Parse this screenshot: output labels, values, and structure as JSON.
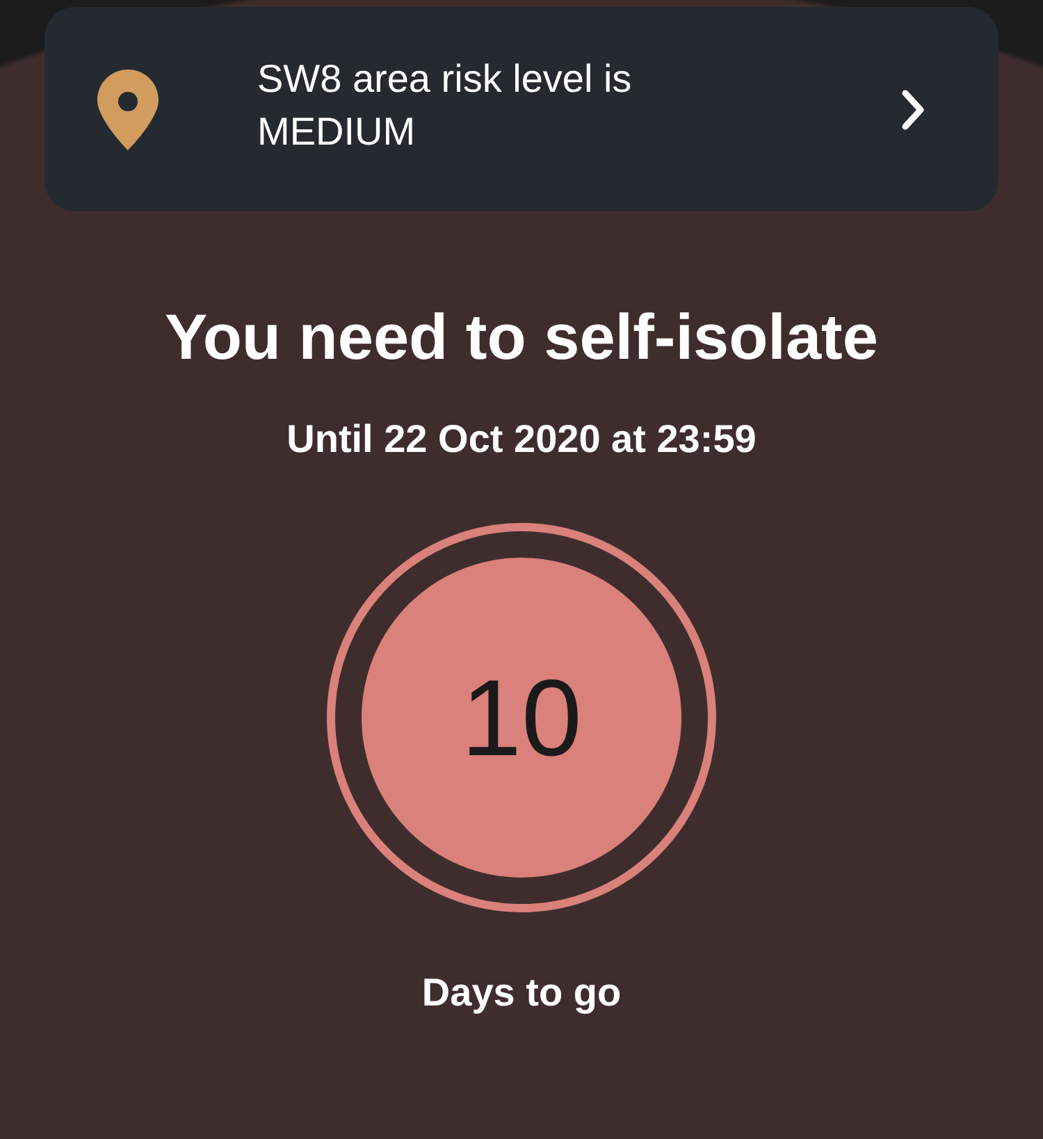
{
  "location_banner": {
    "text": "SW8 area risk level is MEDIUM"
  },
  "isolation": {
    "title": "You need to self-isolate",
    "subtitle": "Until 22 Oct 2020 at 23:59",
    "days_count": "10",
    "days_label": "Days to go"
  }
}
